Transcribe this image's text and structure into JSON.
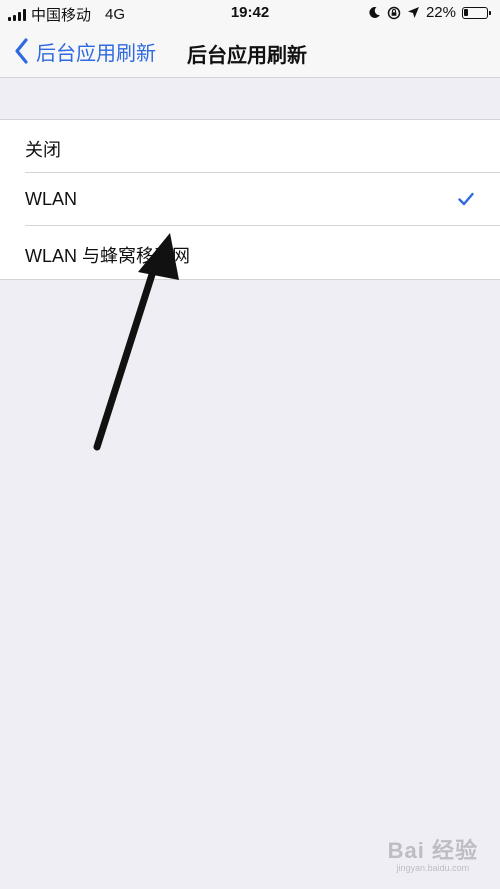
{
  "status_bar": {
    "carrier": "中国移动",
    "network": "4G",
    "time": "19:42",
    "battery": "22%",
    "battery_level": 0.22
  },
  "nav": {
    "back_label": "后台应用刷新",
    "title": "后台应用刷新"
  },
  "options": [
    {
      "label": "关闭",
      "selected": false
    },
    {
      "label": "WLAN",
      "selected": true
    },
    {
      "label": "WLAN 与蜂窝移动网",
      "selected": false
    }
  ],
  "colors": {
    "accent": "#2f6ae0",
    "background": "#efeef4",
    "annotation_arrow": "#111111"
  },
  "watermark": {
    "main": "Bai 经验",
    "sub": "jingyan.baidu.com"
  }
}
